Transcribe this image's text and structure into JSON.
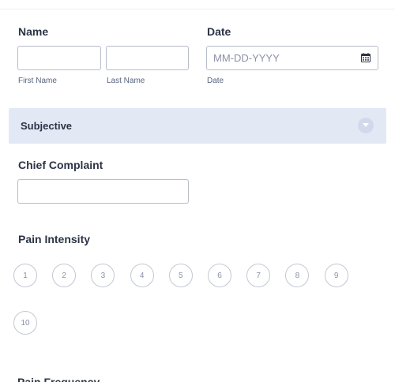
{
  "name": {
    "label": "Name",
    "first_sublabel": "First Name",
    "last_sublabel": "Last Name"
  },
  "date": {
    "label": "Date",
    "placeholder": "MM-DD-YYYY",
    "sublabel": "Date",
    "icon": "calendar-icon"
  },
  "section": {
    "title": "Subjective",
    "toggle_icon": "chevron-down-icon"
  },
  "chief_complaint": {
    "label": "Chief Complaint"
  },
  "pain_intensity": {
    "label": "Pain Intensity",
    "options": [
      "1",
      "2",
      "3",
      "4",
      "5",
      "6",
      "7",
      "8",
      "9",
      "10"
    ]
  },
  "pain_frequency": {
    "label": "Pain Frequency"
  },
  "colors": {
    "section_bg": "#e3e8f5",
    "text": "#2c3345",
    "border": "#b8bdc9"
  }
}
